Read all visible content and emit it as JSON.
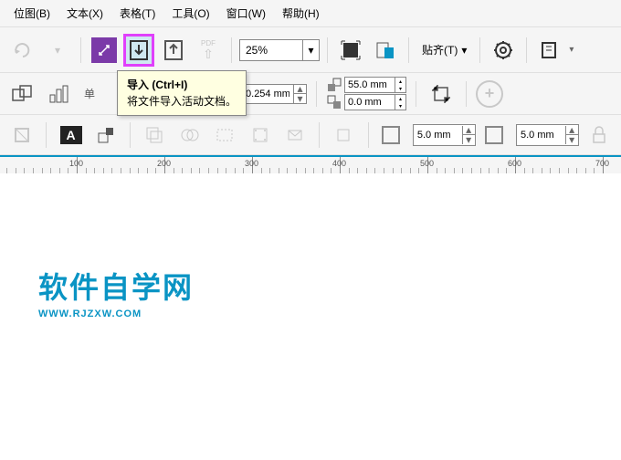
{
  "menu": {
    "view": "位图(B)",
    "text": "文本(X)",
    "table": "表格(T)",
    "tools": "工具(O)",
    "window": "窗口(W)",
    "help": "帮助(H)"
  },
  "zoom": "25%",
  "snap": "贴齐(T)",
  "tooltip": {
    "title": "导入 (Ctrl+I)",
    "desc": "将文件导入活动文档。"
  },
  "prefix": "单",
  "lineWidth": "0.254 mm",
  "dimW": "55.0 mm",
  "dimH": "0.0 mm",
  "sq1": "5.0 mm",
  "sq2": "5.0 mm",
  "ruler": {
    "ticks": [
      84,
      180,
      276,
      372,
      468,
      564,
      660
    ],
    "labels": [
      "100",
      "200",
      "300",
      "400",
      "500",
      "600",
      "700"
    ]
  },
  "wm": {
    "cn": "软件自学网",
    "en": "WWW.RJZXW.COM"
  }
}
